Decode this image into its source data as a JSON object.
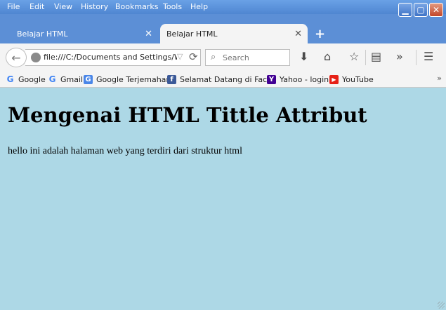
{
  "menu": [
    "File",
    "Edit",
    "View",
    "History",
    "Bookmarks",
    "Tools",
    "Help"
  ],
  "tabs": [
    {
      "title": "Belajar HTML",
      "active": false
    },
    {
      "title": "Belajar HTML",
      "active": true
    }
  ],
  "nav": {
    "url": "file:///C:/Documents and Settings/Win",
    "search_placeholder": "Search"
  },
  "bookmarks": [
    {
      "label": "Google",
      "icon": "google-icon"
    },
    {
      "label": "Gmail",
      "icon": "google-icon"
    },
    {
      "label": "Google Terjemahan",
      "icon": "translate-icon"
    },
    {
      "label": "Selamat Datang di Fac...",
      "icon": "facebook-icon"
    },
    {
      "label": "Yahoo - login",
      "icon": "yahoo-icon"
    },
    {
      "label": "YouTube",
      "icon": "youtube-icon"
    }
  ],
  "page": {
    "heading": "Mengenai HTML Tittle Attribut",
    "paragraph": "hello ini adalah halaman web yang terdiri dari struktur html"
  },
  "colors": {
    "page_bg": "#add8e6",
    "titlebar": "#5c8fd6"
  }
}
